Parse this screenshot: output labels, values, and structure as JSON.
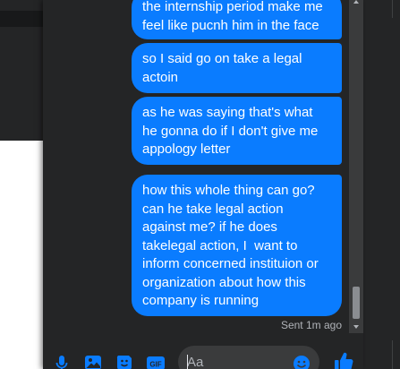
{
  "conversation": {
    "messages": [
      {
        "text": "the internship period make me\nfeel like pucnh him in the face"
      },
      {
        "text": "so I said go on take a legal\nactoin"
      },
      {
        "text": "as he was saying that's what\nhe gonna do if I don't give me\nappology letter"
      },
      {
        "text": "how this whole thing can go?\ncan he take legal action\nagainst me? if he does\ntakelegal action, I  want to\ninform concerned instituion or\norganization about how this\ncompany is running"
      }
    ],
    "status": "Sent 1m ago"
  },
  "composer": {
    "placeholder": "Aa",
    "icons": [
      "microphone-icon",
      "image-icon",
      "sticker-icon",
      "gif-icon",
      "emoji-icon",
      "thumbs-up-icon"
    ]
  },
  "colors": {
    "bubble": "#0a7cff",
    "panel": "#242526",
    "accent": "#0a7cff"
  }
}
